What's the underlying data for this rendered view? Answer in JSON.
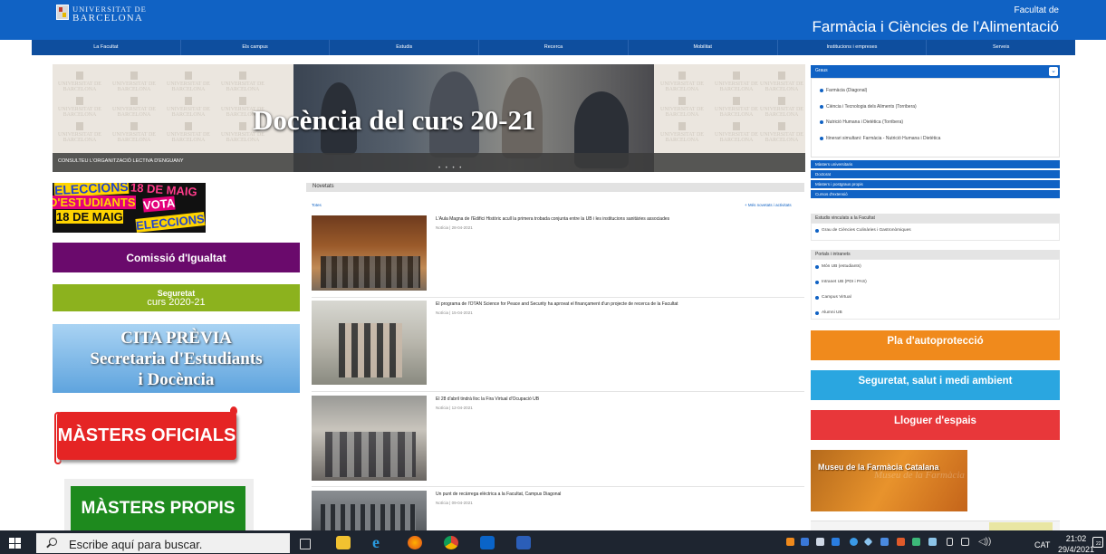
{
  "header": {
    "logo_line1": "UNIVERSITAT DE",
    "logo_line2": "BARCELONA",
    "faculty_pre": "Facultat de",
    "faculty_name": "Farmàcia i Ciències de l'Alimentació"
  },
  "nav": [
    "La Facultat",
    "Els campus",
    "Estudis",
    "Recerca",
    "Mobilitat",
    "Institucions i empreses",
    "Serveis"
  ],
  "banner": {
    "title": "Docència del curs 20-21",
    "caption": "CONSULTEU L'ORGANITZACIÓ LECTIVA D'ENGUANY",
    "dots": "• • • •",
    "watermark_line1": "UNIVERSITAT DE",
    "watermark_line2": "BARCELONA"
  },
  "left": {
    "elecciones": [
      "ELECCIONS",
      "18 DE MAIG",
      "D'ESTUDIANTS",
      "VOTA",
      "18 DE MAIG",
      "ELECCIONS"
    ],
    "igualtat": "Comissió d'Igualtat",
    "seguretat_l1": "Seguretat",
    "seguretat_l2": "curs 2020-21",
    "cita_l1": "CITA PRÈVIA",
    "cita_l2": "Secretaria d'Estudiants",
    "cita_l3": "i Docència",
    "masters_oficials": "MÀSTERS OFICIALS",
    "masters_propis": "MÀSTERS PROPIS"
  },
  "news": {
    "heading": "Novetats",
    "tab": "Totes",
    "more": "+ Més novetats i activitats",
    "items": [
      {
        "title": "L'Aula Magna de l'Edifici Històric acull la primera trobada conjunta entre la UB i les institucions sanitàries associades",
        "meta": "Notícia | 28-04-2021"
      },
      {
        "title": "El programa de l'OTAN Science for Peace and Security ha aprovat el finançament d'un projecte de recerca de la Facultat",
        "meta": "Notícia | 15-04-2021"
      },
      {
        "title": "El 28 d'abril tindrà lloc la Fira Virtual d'Ocupació UB",
        "meta": "Notícia | 12-04-2021"
      },
      {
        "title": "Un punt de recàrrega elèctrica a la Facultat, Campus Diagonal",
        "meta": "Notícia | 09-04-2021"
      }
    ]
  },
  "right": {
    "graus_head": "Graus",
    "graus": [
      "Farmàcia (Diagonal)",
      "Ciència i Tecnologia dels Aliments (Torribera)",
      "Nutrició Humana i Dietètica (Torribera)",
      "Itinerari simultani: Farmàcia - Nutrició Humana i Dietètica"
    ],
    "blue_rows": [
      "Màsters universitaris",
      "Doctorat",
      "Màsters i postgraus propis",
      "Cursos d'extensió"
    ],
    "vinculats_head": "Estudis vinculats a la Facultat",
    "vinculats": [
      "Grau de Ciències Culinàries i Gastronòmiques"
    ],
    "portals_head": "Portals i intranets",
    "portals": [
      "Món UB (estudiants)",
      "Intranet UB (PDI i PAS)",
      "Campus Virtual",
      "Alumni UB"
    ],
    "btn_autoproteccio": "Pla d'autoprotecció",
    "btn_seguretat": "Seguretat, salut i medi ambient",
    "btn_lloguer": "Lloguer d'espais",
    "museu": "Museu de la Farmàcia Catalana",
    "museu_ghost": "Museu de la Farmàcia Catalana"
  },
  "taskbar": {
    "search_placeholder": "Escribe aquí para buscar.",
    "lang": "CAT",
    "time": "21:02",
    "date": "29/4/2021",
    "notif_count": "22"
  },
  "colors": {
    "header_blue": "#1062c4",
    "nav_blue": "#0e4e9e",
    "orange": "#f08a1c",
    "light_blue": "#2aa6e0",
    "red": "#e8373a",
    "purple": "#6a0a6c",
    "green": "#8cb21e"
  }
}
